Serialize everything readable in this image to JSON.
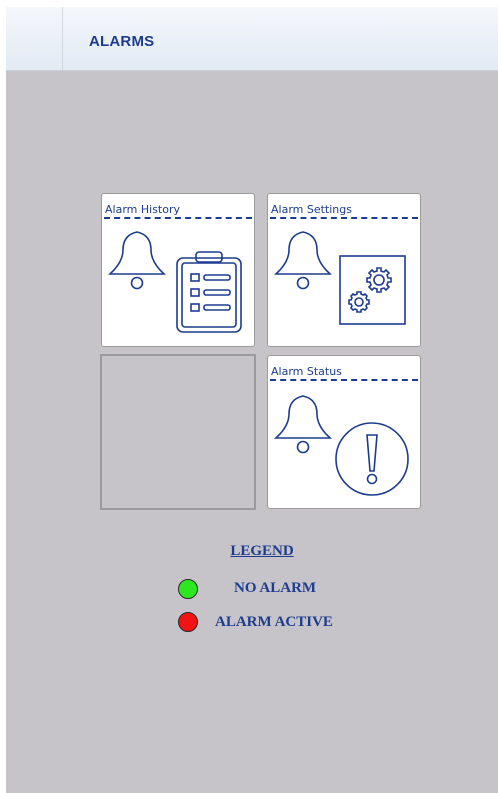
{
  "header": {
    "title": "ALARMS"
  },
  "tiles": {
    "history": {
      "label": "Alarm History"
    },
    "settings": {
      "label": "Alarm Settings"
    },
    "status": {
      "label": "Alarm Status"
    }
  },
  "legend": {
    "title": "LEGEND",
    "items": [
      {
        "label": "NO ALARM",
        "color": "#2ee81f"
      },
      {
        "label": "ALARM ACTIVE",
        "color": "#f21414"
      }
    ]
  },
  "colors": {
    "accent": "#1d3c8f",
    "background": "#c6c4c8"
  }
}
